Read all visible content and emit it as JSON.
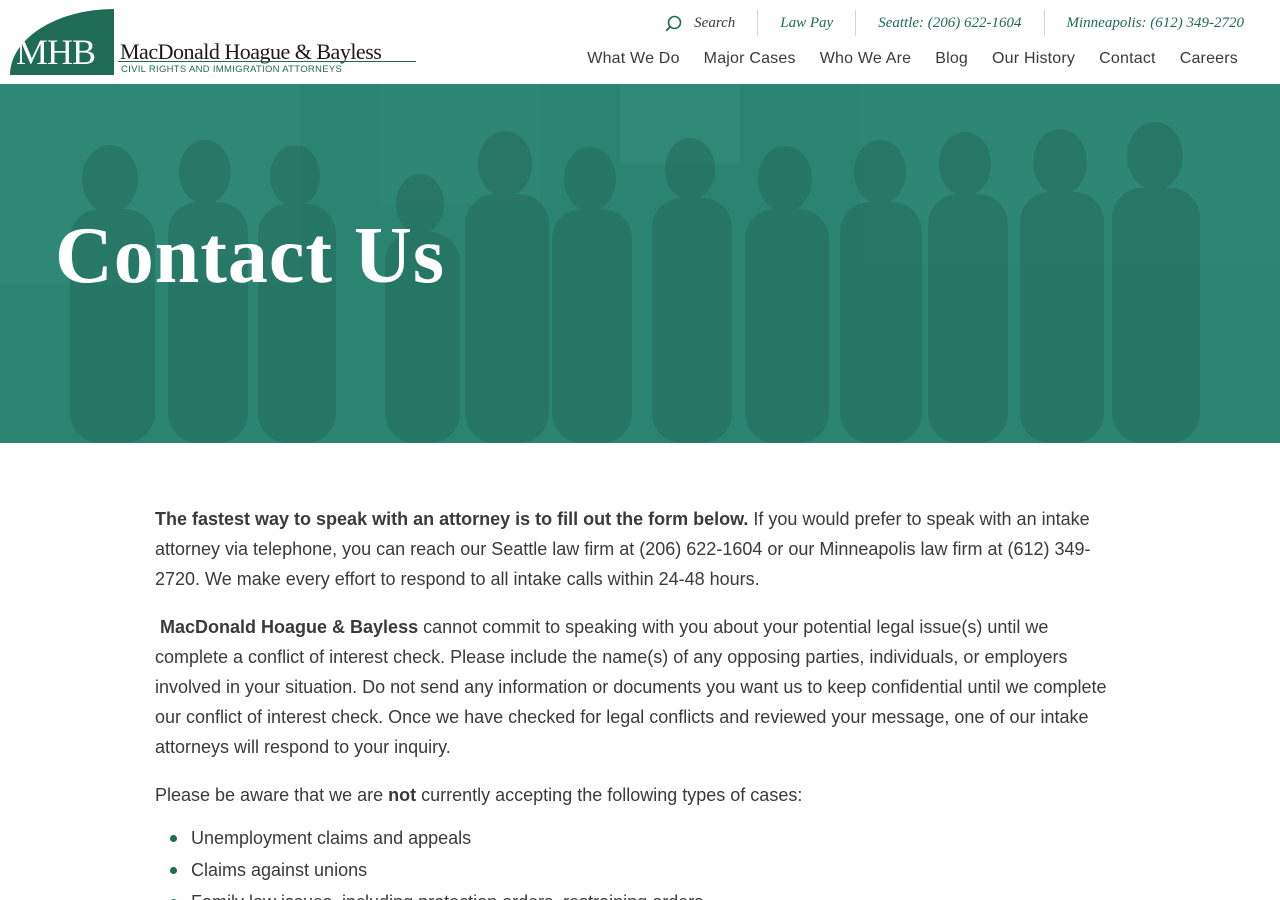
{
  "brand": {
    "monogram": "MHB",
    "name": "MacDonald Hoague & Bayless",
    "tagline": "CIVIL RIGHTS AND IMMIGRATION ATTORNEYS",
    "color": "#1f6b55"
  },
  "utility": {
    "search_label": "Search",
    "law_pay": "Law Pay",
    "seattle": "Seattle: (206) 622-1604",
    "minneapolis": "Minneapolis: (612) 349-2720"
  },
  "nav": [
    {
      "label": "What We Do"
    },
    {
      "label": "Major Cases"
    },
    {
      "label": "Who We Are"
    },
    {
      "label": "Blog"
    },
    {
      "label": "Our History"
    },
    {
      "label": "Contact"
    },
    {
      "label": "Careers"
    }
  ],
  "hero": {
    "title": "Contact Us",
    "overlay_color": "#2a8070"
  },
  "content": {
    "p1_strong": "The fastest way to speak with an attorney is to fill out the form below.",
    "p1_rest": " If you would prefer to speak with an intake attorney via telephone, you can reach our Seattle law firm at (206) 622-1604 or our Minneapolis law firm at (612) 349-2720. We make every effort to respond to all intake calls within 24-48 hours.",
    "p2_strong": "MacDonald Hoague & Bayless",
    "p2_rest": " cannot commit to speaking with you about your potential legal issue(s) until we complete a conflict of interest check. Please include the name(s) of any opposing parties, individuals, or employers involved in your situation.  Do not send any information or documents you want us to keep confidential until we complete our conflict of interest check. Once we have checked for legal conflicts and reviewed your message, one of our intake attorneys will respond to your inquiry.",
    "p3_before": "Please be aware that we are ",
    "p3_strong": "not",
    "p3_after": " currently accepting the following types of cases:",
    "cases": [
      "Unemployment claims and appeals",
      "Claims against unions",
      "Family law issues, including protection orders, restraining orders"
    ]
  }
}
